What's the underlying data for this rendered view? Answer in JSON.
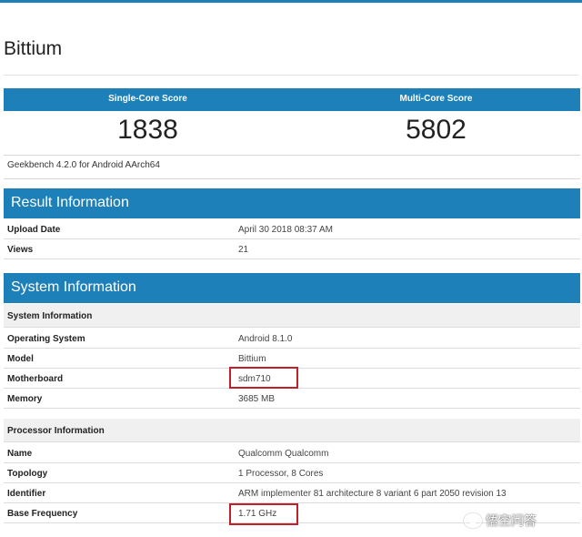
{
  "device": {
    "title": "Bittium"
  },
  "scores": {
    "single_label": "Single-Core Score",
    "multi_label": "Multi-Core Score",
    "single_value": "1838",
    "multi_value": "5802",
    "version": "Geekbench 4.2.0 for Android AArch64"
  },
  "result_info": {
    "title": "Result Information",
    "rows": [
      {
        "label": "Upload Date",
        "value": "April 30 2018 08:37 AM"
      },
      {
        "label": "Views",
        "value": "21"
      }
    ]
  },
  "system_info": {
    "title": "System Information",
    "system_sub": "System Information",
    "system_rows": [
      {
        "label": "Operating System",
        "value": "Android 8.1.0"
      },
      {
        "label": "Model",
        "value": "Bittium"
      },
      {
        "label": "Motherboard",
        "value": "sdm710"
      },
      {
        "label": "Memory",
        "value": "3685 MB"
      }
    ],
    "processor_sub": "Processor Information",
    "processor_rows": [
      {
        "label": "Name",
        "value": "Qualcomm Qualcomm"
      },
      {
        "label": "Topology",
        "value": "1 Processor, 8 Cores"
      },
      {
        "label": "Identifier",
        "value": "ARM implementer 81 architecture 8 variant 6 part 2050 revision 13"
      },
      {
        "label": "Base Frequency",
        "value": "1.71 GHz"
      }
    ]
  },
  "watermark": {
    "text": "悟空问答",
    "icon": "speech-bubble-icon"
  },
  "colors": {
    "accent": "#1d80b8",
    "highlight": "#c0202a"
  }
}
